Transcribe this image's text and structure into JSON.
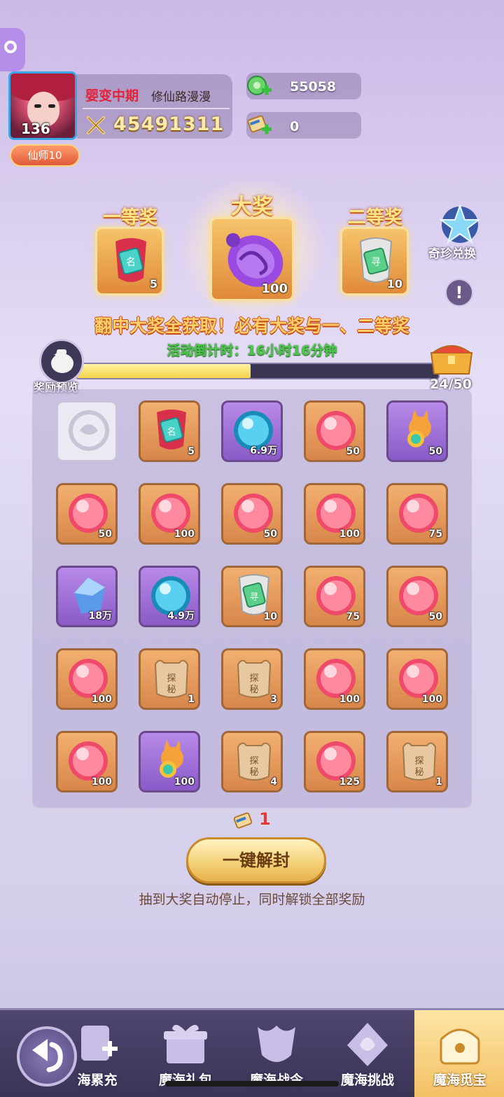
{
  "player": {
    "level": "136",
    "realm": "婴变中期",
    "name": "修仙路漫漫",
    "power": "45491311",
    "title_badge": "仙师10"
  },
  "resources": [
    {
      "icon": "jade-coin-icon",
      "value": "55058"
    },
    {
      "icon": "scroll-ticket-icon",
      "value": "0"
    }
  ],
  "prizes": {
    "first": {
      "title": "一等奖",
      "count": "5"
    },
    "grand": {
      "title": "大奖",
      "count": "100"
    },
    "second": {
      "title": "二等奖",
      "count": "10"
    }
  },
  "exchange_label": "奇珍兑换",
  "help_label": "!",
  "slogan": "翻中大奖全获取！必有大奖与一、二等奖",
  "countdown": "活动倒计时：16小时16分钟",
  "progress": {
    "current": 24,
    "total": 50,
    "text": "24/50"
  },
  "preview_label": "奖励预览",
  "grid": [
    [
      {
        "type": "opened",
        "amount": ""
      },
      {
        "type": "red-token",
        "amount": "5",
        "bg": "orange"
      },
      {
        "type": "blue-orb",
        "amount": "6.9万",
        "bg": "purple"
      },
      {
        "type": "red-orb",
        "amount": "50",
        "bg": "orange"
      },
      {
        "type": "fox",
        "amount": "50",
        "bg": "purple"
      }
    ],
    [
      {
        "type": "red-orb",
        "amount": "50",
        "bg": "orange"
      },
      {
        "type": "red-orb",
        "amount": "100",
        "bg": "orange"
      },
      {
        "type": "red-orb",
        "amount": "50",
        "bg": "orange"
      },
      {
        "type": "red-orb",
        "amount": "100",
        "bg": "orange"
      },
      {
        "type": "red-orb",
        "amount": "75",
        "bg": "orange"
      }
    ],
    [
      {
        "type": "crystal",
        "amount": "18万",
        "bg": "purple"
      },
      {
        "type": "blue-orb",
        "amount": "4.9万",
        "bg": "purple"
      },
      {
        "type": "green-token",
        "amount": "10",
        "bg": "orange"
      },
      {
        "type": "red-orb",
        "amount": "75",
        "bg": "orange"
      },
      {
        "type": "red-orb",
        "amount": "50",
        "bg": "orange"
      }
    ],
    [
      {
        "type": "red-orb",
        "amount": "100",
        "bg": "orange"
      },
      {
        "type": "explore-tag",
        "amount": "1",
        "bg": "orange"
      },
      {
        "type": "explore-tag",
        "amount": "3",
        "bg": "orange"
      },
      {
        "type": "red-orb",
        "amount": "100",
        "bg": "orange"
      },
      {
        "type": "red-orb",
        "amount": "100",
        "bg": "orange"
      }
    ],
    [
      {
        "type": "red-orb",
        "amount": "100",
        "bg": "orange"
      },
      {
        "type": "fox",
        "amount": "100",
        "bg": "purple"
      },
      {
        "type": "explore-tag",
        "amount": "4",
        "bg": "orange"
      },
      {
        "type": "red-orb",
        "amount": "125",
        "bg": "orange"
      },
      {
        "type": "explore-tag",
        "amount": "1",
        "bg": "orange"
      }
    ]
  ],
  "ticket_count": "1",
  "unseal_button": "一键解封",
  "hint": "抽到大奖自动停止，同时解锁全部奖励",
  "nav": [
    {
      "label": "海累充",
      "icon": "recharge-icon"
    },
    {
      "label": "魔海礼包",
      "icon": "gift-icon"
    },
    {
      "label": "魔海战令",
      "icon": "war-order-icon"
    },
    {
      "label": "魔海挑战",
      "icon": "challenge-icon"
    },
    {
      "label": "魔海觅宝",
      "icon": "treasure-icon",
      "active": true
    }
  ]
}
